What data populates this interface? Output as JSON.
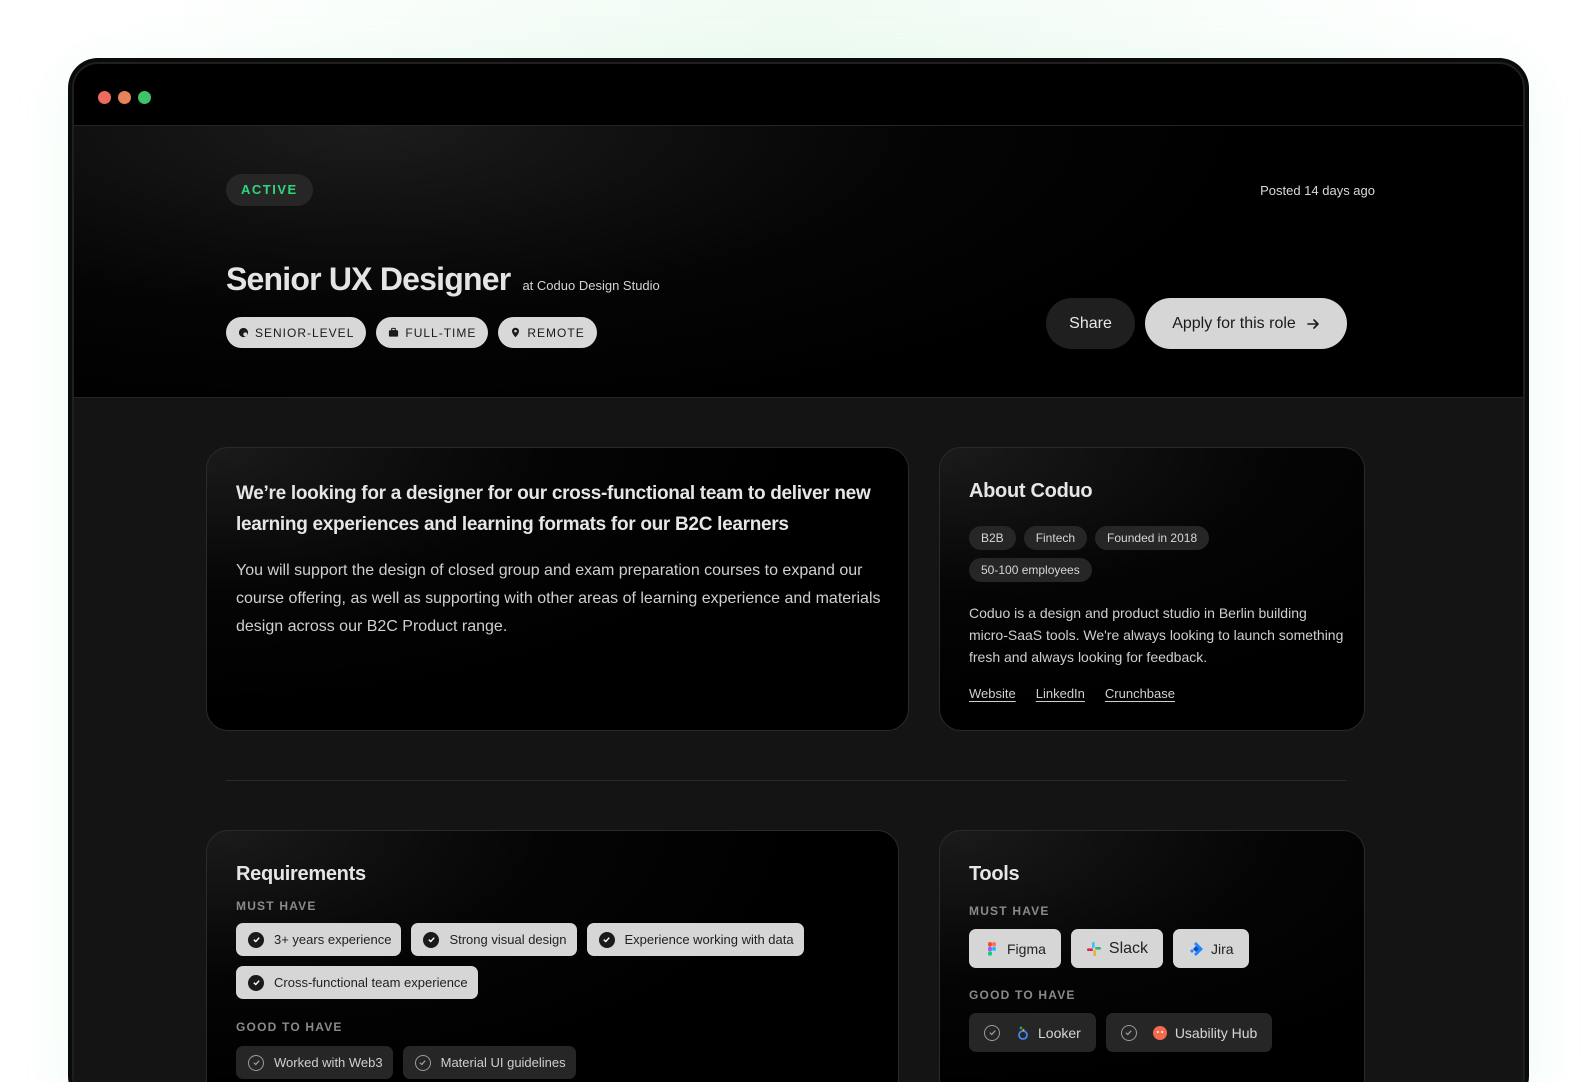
{
  "hero": {
    "status": "ACTIVE",
    "posted": "Posted 14 days ago",
    "title": "Senior UX Designer",
    "company": "at Coduo Design Studio",
    "chips": [
      "SENIOR-LEVEL",
      "FULL-TIME",
      "REMOTE"
    ],
    "share_label": "Share",
    "apply_label": "Apply for this role"
  },
  "intro": {
    "heading": "We’re looking for a designer for our cross-functional team to deliver new learning experiences and learning formats for our B2C learners",
    "body": "You will support the design of closed group and exam preparation courses to expand our course offering, as well as supporting with other areas of learning experience and materials design across our B2C Product range."
  },
  "about": {
    "title": "About Coduo",
    "tags": [
      "B2B",
      "Fintech",
      "Founded in 2018",
      "50-100 employees"
    ],
    "body": "Coduo is a design and product studio in Berlin building micro-SaaS tools. We're always looking to launch something fresh and always looking for feedback.",
    "links": [
      "Website",
      "LinkedIn",
      "Crunchbase"
    ]
  },
  "requirements": {
    "title": "Requirements",
    "must_label": "MUST HAVE",
    "must": [
      "3+ years experience",
      "Strong visual design",
      "Experience working with data",
      "Cross-functional team experience"
    ],
    "good_label": "GOOD TO HAVE",
    "good": [
      "Worked with Web3",
      "Material UI guidelines"
    ]
  },
  "tools": {
    "title": "Tools",
    "must_label": "MUST HAVE",
    "must": [
      "Figma",
      "Slack",
      "Jira"
    ],
    "good_label": "GOOD TO HAVE",
    "good": [
      "Looker",
      "Usability Hub"
    ]
  },
  "colors": {
    "active_green": "#2fd67c",
    "window_bg": "#000000",
    "pill_light": "#d6d6d6"
  }
}
